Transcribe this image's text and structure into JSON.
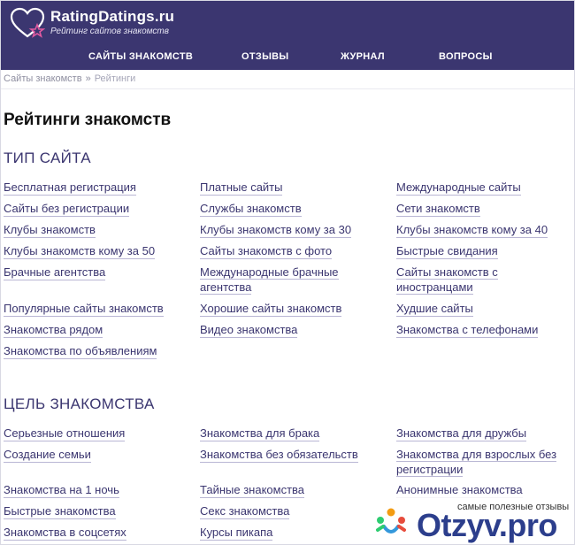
{
  "header": {
    "logo_title": "RatingDatings.ru",
    "logo_subtitle": "Рейтинг сайтов знакомств",
    "nav": [
      "САЙТЫ ЗНАКОМСТВ",
      "ОТЗЫВЫ",
      "ЖУРНАЛ",
      "ВОПРОСЫ"
    ],
    "bg_color": "#3b3670"
  },
  "breadcrumb": {
    "home": "Сайты знакомств",
    "separator": "»",
    "current": "Рейтинги"
  },
  "page_title": "Рейтинги знакомств",
  "sections": [
    {
      "title": "ТИП САЙТА",
      "links": [
        "Бесплатная регистрация",
        "Платные сайты",
        "Международные сайты",
        "Сайты без регистрации",
        "Службы знакомств",
        "Сети знакомств",
        "Клубы знакомств",
        "Клубы знакомств кому за 30",
        "Клубы знакомств кому за 40",
        "Клубы знакомств кому за 50",
        "Сайты знакомств с фото",
        "Быстрые свидания",
        "Брачные агентства",
        "Международные брачные агентства",
        "Сайты знакомств с иностранцами",
        "Популярные сайты знакомств",
        "Хорошие сайты знакомств",
        "Худшие сайты",
        "Знакомства рядом",
        "Видео знакомства",
        "Знакомства с телефонами",
        "Знакомства по объявлениям"
      ]
    },
    {
      "title": "ЦЕЛЬ ЗНАКОМСТВА",
      "links": [
        "Серьезные отношения",
        "Знакомства для брака",
        "Знакомства для дружбы",
        "Создание семьи",
        "Знакомства без обязательств",
        "Знакомства для взрослых без регистрации",
        "Знакомства на 1 ночь",
        "Тайные знакомства",
        "Анонимные знакомства",
        "Быстрые знакомства",
        "Секс знакомства",
        "Знакомства в соцсетях",
        "Курсы пикапа"
      ]
    }
  ],
  "watermark": {
    "caption": "самые полезные отзывы",
    "logo": "Otzyv.pro"
  }
}
